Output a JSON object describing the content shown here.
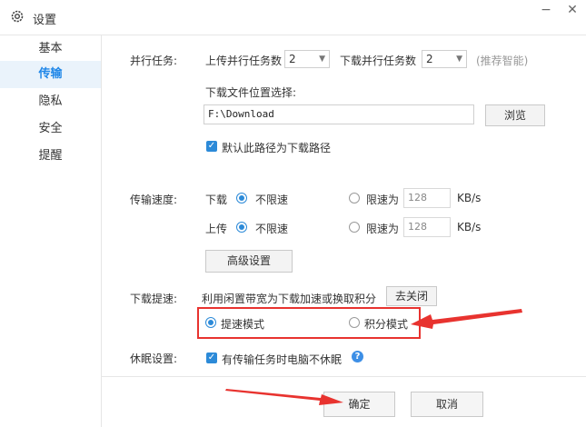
{
  "window": {
    "title": "设置"
  },
  "sidebar": {
    "items": [
      {
        "label": "基本"
      },
      {
        "label": "传输"
      },
      {
        "label": "隐私"
      },
      {
        "label": "安全"
      },
      {
        "label": "提醒"
      }
    ],
    "active_index": 1
  },
  "parallel": {
    "section_label": "并行任务:",
    "upload_label": "上传并行任务数",
    "upload_value": "2",
    "download_label": "下载并行任务数",
    "download_value": "2",
    "hint": "(推荐智能)"
  },
  "download_location": {
    "label": "下载文件位置选择:",
    "path": "F:\\Download",
    "browse_label": "浏览",
    "default_checkbox_label": "默认此路径为下载路径",
    "default_checked": true
  },
  "speed": {
    "section_label": "传输速度:",
    "download_label": "下载",
    "upload_label": "上传",
    "unlimited_label": "不限速",
    "limit_label": "限速为",
    "download_limit_value": "128",
    "upload_limit_value": "128",
    "unit": "KB/s",
    "download_mode": "unlimited",
    "upload_mode": "unlimited",
    "advanced_label": "高级设置"
  },
  "acceleration": {
    "section_label": "下载提速:",
    "description": "利用闲置带宽为下载加速或换取积分",
    "close_label": "去关闭",
    "mode_speed_label": "提速模式",
    "mode_points_label": "积分模式",
    "selected_mode": "speed"
  },
  "sleep": {
    "section_label": "休眠设置:",
    "checkbox_label": "有传输任务时电脑不休眠",
    "checked": true
  },
  "footer": {
    "ok_label": "确定",
    "cancel_label": "取消"
  },
  "colors": {
    "accent": "#2c8ad8",
    "active_sidebar_bg": "#eaf3fb",
    "annotation_red": "#e8332f"
  }
}
